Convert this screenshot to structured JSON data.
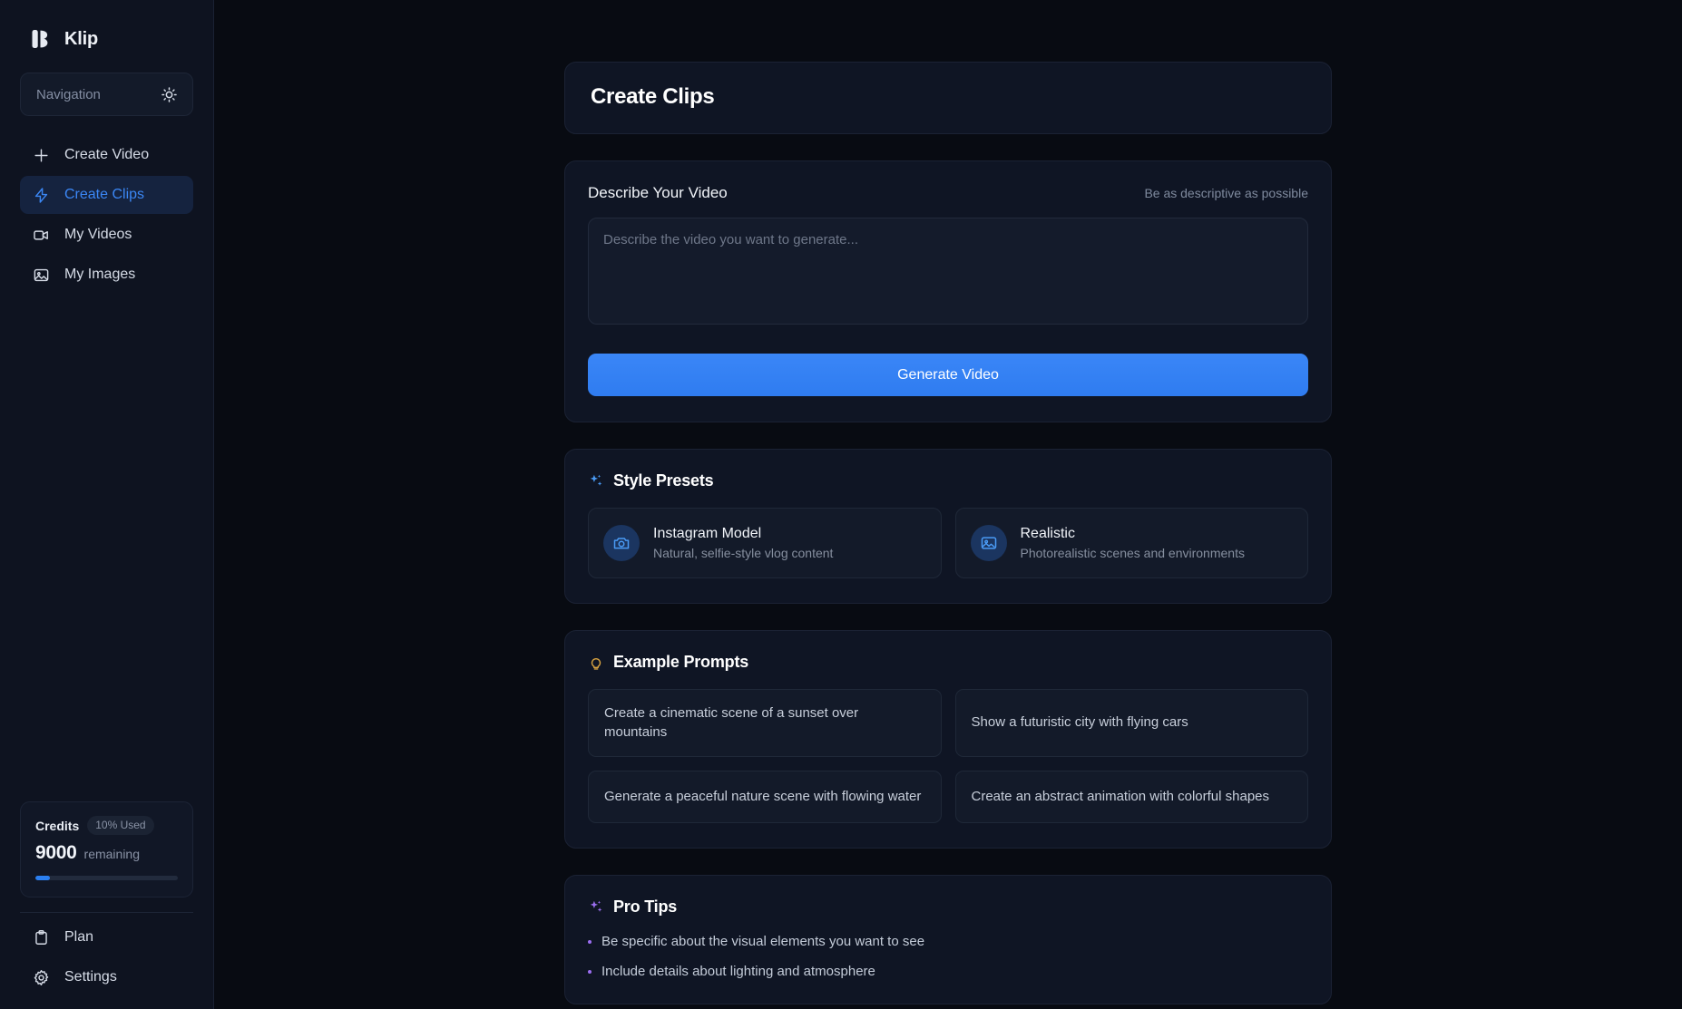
{
  "brand": {
    "name": "Klip",
    "logo_icon": "klip-logo-icon"
  },
  "sidebar": {
    "search": {
      "label": "Navigation",
      "theme_icon": "sun-icon"
    },
    "items": [
      {
        "label": "Create Video",
        "icon": "plus-icon",
        "active": false
      },
      {
        "label": "Create Clips",
        "icon": "lightning-bolt-icon",
        "active": true
      },
      {
        "label": "My Videos",
        "icon": "video-camera-icon",
        "active": false
      },
      {
        "label": "My Images",
        "icon": "image-icon",
        "active": false
      }
    ],
    "credits": {
      "title": "Credits",
      "used_badge": "10% Used",
      "amount": "9000",
      "amount_suffix": "remaining",
      "progress_percent": 10,
      "accent_color": "#2b7ff0"
    },
    "bottom_items": [
      {
        "label": "Plan",
        "icon": "clipboard-icon"
      },
      {
        "label": "Settings",
        "icon": "gear-icon"
      }
    ]
  },
  "header": {
    "title": "Create Clips"
  },
  "describe": {
    "label": "Describe Your Video",
    "hint": "Be as descriptive as possible",
    "placeholder": "Describe the video you want to generate...",
    "value": "",
    "generate_label": "Generate Video",
    "generate_color": "#2f7cf0"
  },
  "style_presets": {
    "title": "Style Presets",
    "icon": "sparkles-icon",
    "icon_color": "#4a9bf5",
    "items": [
      {
        "title": "Instagram Model",
        "desc": "Natural, selfie-style vlog content",
        "icon": "camera-icon"
      },
      {
        "title": "Realistic",
        "desc": "Photorealistic scenes and environments",
        "icon": "image-icon"
      }
    ]
  },
  "example_prompts": {
    "title": "Example Prompts",
    "icon": "lightbulb-icon",
    "icon_color": "#d9a441",
    "items": [
      "Create a cinematic scene of a sunset over mountains",
      "Show a futuristic city with flying cars",
      "Generate a peaceful nature scene with flowing water",
      "Create an abstract animation with colorful shapes"
    ]
  },
  "pro_tips": {
    "title": "Pro Tips",
    "icon": "sparkles-icon",
    "icon_color": "#9b6ef0",
    "items": [
      "Be specific about the visual elements you want to see",
      "Include details about lighting and atmosphere"
    ]
  }
}
